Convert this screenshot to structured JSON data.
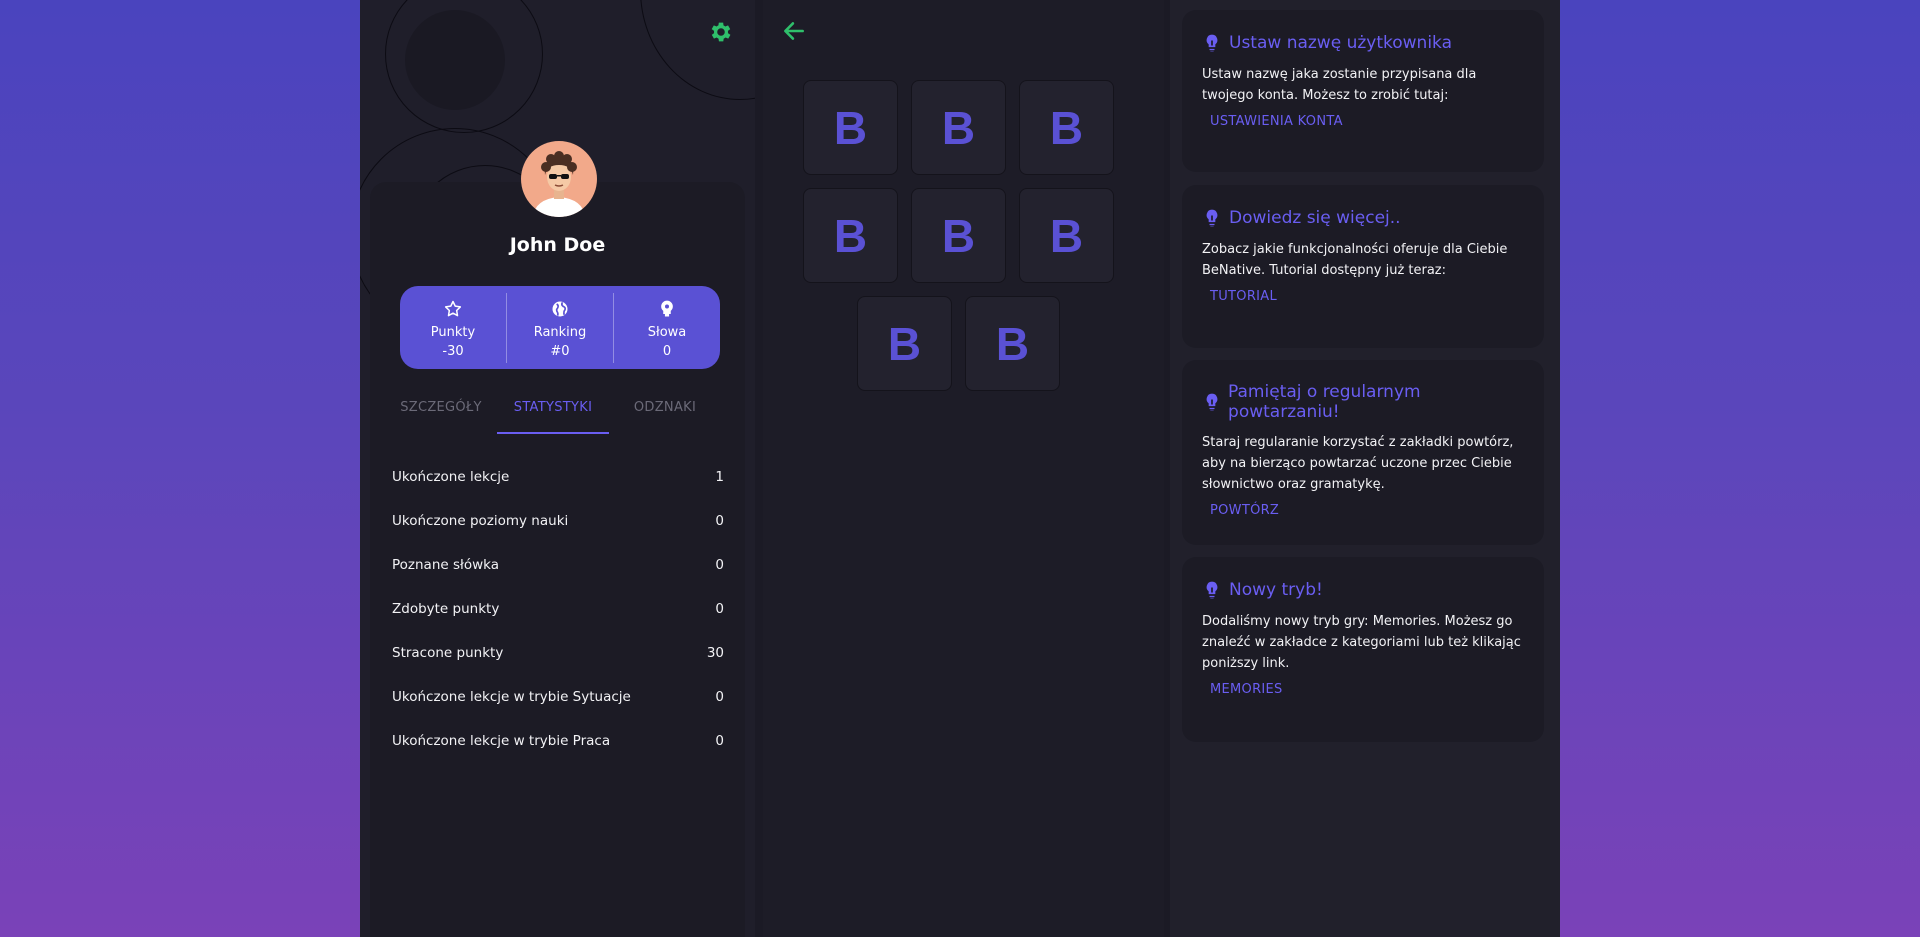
{
  "profile": {
    "name": "John Doe",
    "stats": [
      {
        "icon": "star-icon",
        "label": "Punkty",
        "value": "-30"
      },
      {
        "icon": "globe-icon",
        "label": "Ranking",
        "value": "#0"
      },
      {
        "icon": "brain-icon",
        "label": "Słowa",
        "value": "0"
      }
    ],
    "tabs": [
      {
        "label": "SZCZEGÓŁY",
        "active": false
      },
      {
        "label": "STATYSTYKI",
        "active": true
      },
      {
        "label": "ODZNAKI",
        "active": false
      }
    ],
    "statistics": [
      {
        "label": "Ukończone lekcje",
        "value": "1"
      },
      {
        "label": "Ukończone poziomy nauki",
        "value": "0"
      },
      {
        "label": "Poznane słówka",
        "value": "0"
      },
      {
        "label": "Zdobyte punkty",
        "value": "0"
      },
      {
        "label": "Stracone punkty",
        "value": "30"
      },
      {
        "label": "Ukończone lekcje w trybie Sytuacje",
        "value": "0"
      },
      {
        "label": "Ukończone lekcje w trybie Praca",
        "value": "0"
      }
    ]
  },
  "game": {
    "tiles": [
      "B",
      "B",
      "B",
      "B",
      "B",
      "B",
      "B",
      "B"
    ]
  },
  "sidebar": {
    "cards": [
      {
        "title": "Ustaw nazwę użytkownika",
        "body": "Ustaw nazwę jaka zostanie przypisana dla twojego konta. Możesz to zrobić tutaj:",
        "link": "USTAWIENIA KONTA"
      },
      {
        "title": "Dowiedz się więcej..",
        "body": "Zobacz jakie funkcjonalności oferuje dla Ciebie BeNative. Tutorial dostępny już teraz:",
        "link": "TUTORIAL"
      },
      {
        "title": "Pamiętaj o regularnym powtarzaniu!",
        "body": "Staraj regularanie korzystać z zakładki powtórz, aby na bierząco powtarzać uczone przec Ciebie słownictwo oraz gramatykę.",
        "link": "POWTÓRZ"
      },
      {
        "title": "Nowy tryb!",
        "body": "Dodaliśmy nowy tryb gry: Memories. Możesz go znaleźć w zakładce z kategoriami lub też klikając poniższy link.",
        "link": "MEMORIES"
      }
    ]
  },
  "colors": {
    "accent": "#5a51d4",
    "link": "#6a5ef2",
    "icon_green": "#2fbf6b",
    "panel": "#1f1e2a"
  }
}
